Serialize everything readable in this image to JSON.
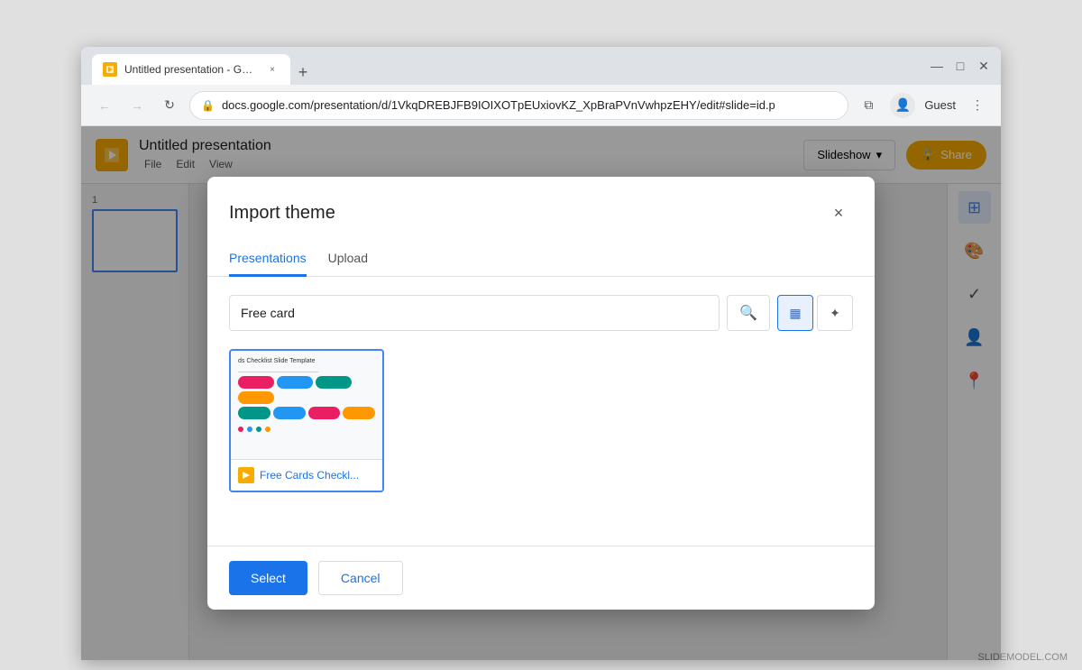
{
  "browser": {
    "tab_title": "Untitled presentation - Google S",
    "tab_close": "×",
    "new_tab": "+",
    "win_minimize": "—",
    "win_maximize": "◻",
    "win_close": "×",
    "back_arrow": "←",
    "forward_arrow": "→",
    "reload": "↻",
    "address": "docs.google.com/presentation/d/1VkqDREBJFB9IOIXOTpEUxiovKZ_XpBraPVnVwhpzEHY/edit#slide=id.p",
    "profile_label": "Guest",
    "menu_dots": "⋮",
    "extensions_icon": "⧉"
  },
  "slides_app": {
    "logo_letter": "▶",
    "title": "Untitled presentation",
    "menu_items": [
      "File",
      "Edit",
      "V"
    ],
    "slideshow_label": "Slideshow",
    "share_label": "Share",
    "slide_number": "1"
  },
  "modal": {
    "title": "Import theme",
    "close_label": "×",
    "tabs": [
      {
        "label": "Presentations",
        "active": true
      },
      {
        "label": "Upload",
        "active": false
      }
    ],
    "search": {
      "placeholder": "Free card",
      "value": "Free card",
      "search_icon": "🔍"
    },
    "view_grid_icon": "▦",
    "view_list_icon": "✦",
    "results": [
      {
        "name": "Free Cards Checkl...",
        "icon_letter": "▶"
      }
    ],
    "select_label": "Select",
    "cancel_label": "Cancel"
  },
  "footer": {
    "import_theme_label": "Import theme"
  },
  "watermark": "SLIDEMODEL.COM"
}
